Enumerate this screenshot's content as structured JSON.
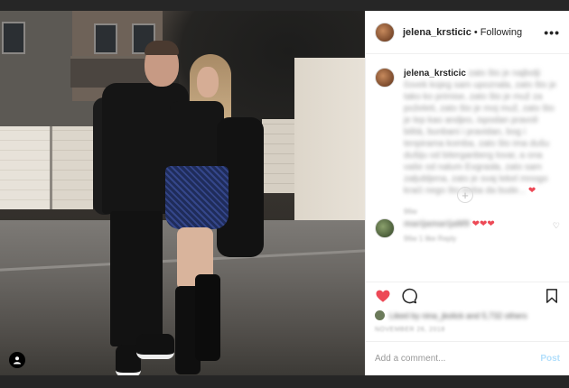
{
  "header": {
    "username": "jelena_krsticic",
    "separator": "•",
    "follow_status": "Following",
    "more_icon": "more-horizontal-icon"
  },
  "caption": {
    "username": "jelena_krsticic",
    "text": "zato što je najbolji čovek kojeg sam upoznala, zato što je tako ko primise, zato što je muž za poželeti, zato što je moj muž, zato što je lep kao andjeo, ispodan pravoli bilità, bunbani i pravidan, bog i tenpirama komba, zato što ima dušu dušiju od biterganberg lovar, a ona vaše od nalum Evgrasła, zato sam zaljubljena, zato je svaj lekel mnogo kraći nego što treba da bude...",
    "time": "96w"
  },
  "load_more_icon": "plus-circle-icon",
  "reply": {
    "username": "marijamarijaM9",
    "hearts": "❤❤❤",
    "meta": "96w  1 like  Reply"
  },
  "actions": {
    "like_icon": "heart-filled-icon",
    "comment_icon": "comment-icon",
    "save_icon": "bookmark-icon",
    "like_color": "#ed4956"
  },
  "likes": {
    "text": "Liked by nina_jkolick and 5,732 others"
  },
  "post_time": "NOVEMBER 26, 2018",
  "add_comment": {
    "placeholder": "Add a comment...",
    "post_label": "Post"
  }
}
